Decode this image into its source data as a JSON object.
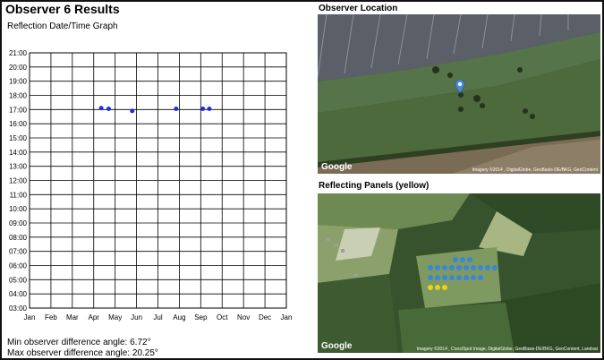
{
  "header": {
    "title": "Observer 6 Results",
    "graph_title": "Reflection Date/Time Graph"
  },
  "chart_data": {
    "type": "scatter",
    "title": "Reflection Date/Time Graph",
    "xlabel": "",
    "ylabel": "",
    "x_categories": [
      "Jan",
      "Feb",
      "Mar",
      "Apr",
      "May",
      "Jun",
      "Jul",
      "Aug",
      "Sep",
      "Oct",
      "Nov",
      "Dec",
      "Jan"
    ],
    "y_ticks": [
      "03:00",
      "04:00",
      "05:00",
      "06:00",
      "07:00",
      "08:00",
      "09:00",
      "10:00",
      "11:00",
      "12:00",
      "13:00",
      "14:00",
      "15:00",
      "16:00",
      "17:00",
      "18:00",
      "19:00",
      "20:00",
      "21:00"
    ],
    "ylim": [
      "03:00",
      "21:00"
    ],
    "grid": true,
    "point_color": "#1f2fd6",
    "points": [
      {
        "month_index": 3.35,
        "time_hours": 17.1
      },
      {
        "month_index": 3.7,
        "time_hours": 17.05
      },
      {
        "month_index": 4.8,
        "time_hours": 16.9
      },
      {
        "month_index": 6.85,
        "time_hours": 17.05
      },
      {
        "month_index": 8.1,
        "time_hours": 17.05
      },
      {
        "month_index": 8.4,
        "time_hours": 17.05
      }
    ]
  },
  "stats": {
    "min_angle": "Min observer difference angle: 6.72°",
    "max_angle": "Max observer difference angle: 20.25°"
  },
  "maps": {
    "observer": {
      "title": "Observer Location",
      "logo": "Google",
      "attribution": "Imagery ©2014 , DigitalGlobe, GeoBasis-DE/BKG, GeoContent",
      "marker_icon": "map-pin-icon",
      "marker_color": "#4a8de0"
    },
    "panels": {
      "title": "Reflecting Panels (yellow)",
      "logo": "Google",
      "attribution": "Imagery ©2014 , Cnes/Spot Image, DigitalGlobe, GeoBasis-DE/BKG, GeoContent, Landsat",
      "panel_color_blue": "#3a86d6",
      "panel_color_yellow": "#e8d21c"
    }
  }
}
